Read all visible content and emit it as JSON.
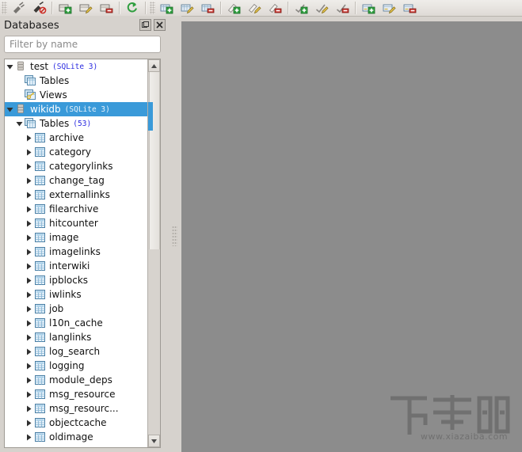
{
  "toolbar": {
    "groups": [
      {
        "name": "connect-group",
        "buttons": [
          {
            "name": "connect-icon",
            "glyph": "plug"
          },
          {
            "name": "disconnect-icon",
            "glyph": "plug-off"
          }
        ]
      },
      {
        "name": "database-group",
        "buttons": [
          {
            "name": "add-database-icon",
            "glyph": "db-add"
          },
          {
            "name": "edit-database-icon",
            "glyph": "db-edit"
          },
          {
            "name": "delete-database-icon",
            "glyph": "db-delete"
          }
        ]
      },
      {
        "name": "refresh-group",
        "buttons": [
          {
            "name": "refresh-icon",
            "glyph": "refresh"
          }
        ]
      },
      {
        "name": "table-group",
        "buttons": [
          {
            "name": "add-table-icon",
            "glyph": "table-add"
          },
          {
            "name": "edit-table-icon",
            "glyph": "table-edit"
          },
          {
            "name": "delete-table-icon",
            "glyph": "table-delete"
          }
        ]
      },
      {
        "name": "index-group",
        "buttons": [
          {
            "name": "add-index-icon",
            "glyph": "index-add"
          },
          {
            "name": "edit-index-icon",
            "glyph": "index-edit"
          },
          {
            "name": "delete-index-icon",
            "glyph": "index-delete"
          }
        ]
      },
      {
        "name": "trigger-group",
        "buttons": [
          {
            "name": "add-trigger-icon",
            "glyph": "trigger-add"
          },
          {
            "name": "edit-trigger-icon",
            "glyph": "trigger-edit"
          },
          {
            "name": "delete-trigger-icon",
            "glyph": "trigger-delete"
          }
        ]
      },
      {
        "name": "view-group",
        "buttons": [
          {
            "name": "add-view-icon",
            "glyph": "view-add"
          },
          {
            "name": "edit-view-icon",
            "glyph": "view-edit"
          },
          {
            "name": "delete-view-icon",
            "glyph": "view-delete"
          }
        ]
      }
    ]
  },
  "panel": {
    "title": "Databases",
    "float_button_label": "",
    "close_button_label": ""
  },
  "filter": {
    "value": "",
    "placeholder": "Filter by name"
  },
  "tree": {
    "nodes": [
      {
        "label": "test",
        "suffix": "(SQLite 3)",
        "indent": 0,
        "twisty": "down",
        "icon": "database-icon",
        "selected": false
      },
      {
        "label": "Tables",
        "suffix": "",
        "indent": 1,
        "twisty": "none",
        "icon": "tables-icon",
        "selected": false
      },
      {
        "label": "Views",
        "suffix": "",
        "indent": 1,
        "twisty": "none",
        "icon": "views-icon",
        "selected": false
      },
      {
        "label": "wikidb",
        "suffix": "(SQLite 3)",
        "indent": 0,
        "twisty": "down",
        "icon": "database-icon",
        "selected": true
      },
      {
        "label": "Tables",
        "suffix": "(53)",
        "indent": 1,
        "twisty": "down",
        "icon": "tables-icon",
        "selected": false
      },
      {
        "label": "archive",
        "suffix": "",
        "indent": 2,
        "twisty": "right",
        "icon": "table-icon",
        "selected": false
      },
      {
        "label": "category",
        "suffix": "",
        "indent": 2,
        "twisty": "right",
        "icon": "table-icon",
        "selected": false
      },
      {
        "label": "categorylinks",
        "suffix": "",
        "indent": 2,
        "twisty": "right",
        "icon": "table-icon",
        "selected": false
      },
      {
        "label": "change_tag",
        "suffix": "",
        "indent": 2,
        "twisty": "right",
        "icon": "table-icon",
        "selected": false
      },
      {
        "label": "externallinks",
        "suffix": "",
        "indent": 2,
        "twisty": "right",
        "icon": "table-icon",
        "selected": false
      },
      {
        "label": "filearchive",
        "suffix": "",
        "indent": 2,
        "twisty": "right",
        "icon": "table-icon",
        "selected": false
      },
      {
        "label": "hitcounter",
        "suffix": "",
        "indent": 2,
        "twisty": "right",
        "icon": "table-icon",
        "selected": false
      },
      {
        "label": "image",
        "suffix": "",
        "indent": 2,
        "twisty": "right",
        "icon": "table-icon",
        "selected": false
      },
      {
        "label": "imagelinks",
        "suffix": "",
        "indent": 2,
        "twisty": "right",
        "icon": "table-icon",
        "selected": false
      },
      {
        "label": "interwiki",
        "suffix": "",
        "indent": 2,
        "twisty": "right",
        "icon": "table-icon",
        "selected": false
      },
      {
        "label": "ipblocks",
        "suffix": "",
        "indent": 2,
        "twisty": "right",
        "icon": "table-icon",
        "selected": false
      },
      {
        "label": "iwlinks",
        "suffix": "",
        "indent": 2,
        "twisty": "right",
        "icon": "table-icon",
        "selected": false
      },
      {
        "label": "job",
        "suffix": "",
        "indent": 2,
        "twisty": "right",
        "icon": "table-icon",
        "selected": false
      },
      {
        "label": "l10n_cache",
        "suffix": "",
        "indent": 2,
        "twisty": "right",
        "icon": "table-icon",
        "selected": false
      },
      {
        "label": "langlinks",
        "suffix": "",
        "indent": 2,
        "twisty": "right",
        "icon": "table-icon",
        "selected": false
      },
      {
        "label": "log_search",
        "suffix": "",
        "indent": 2,
        "twisty": "right",
        "icon": "table-icon",
        "selected": false
      },
      {
        "label": "logging",
        "suffix": "",
        "indent": 2,
        "twisty": "right",
        "icon": "table-icon",
        "selected": false
      },
      {
        "label": "module_deps",
        "suffix": "",
        "indent": 2,
        "twisty": "right",
        "icon": "table-icon",
        "selected": false
      },
      {
        "label": "msg_resource",
        "suffix": "",
        "indent": 2,
        "twisty": "right",
        "icon": "table-icon",
        "selected": false
      },
      {
        "label": "msg_resourc...",
        "suffix": "",
        "indent": 2,
        "twisty": "right",
        "icon": "table-icon",
        "selected": false
      },
      {
        "label": "objectcache",
        "suffix": "",
        "indent": 2,
        "twisty": "right",
        "icon": "table-icon",
        "selected": false
      },
      {
        "label": "oldimage",
        "suffix": "",
        "indent": 2,
        "twisty": "right",
        "icon": "table-icon",
        "selected": false
      }
    ]
  },
  "scrollbar": {
    "up_arrow": "scroll-up-icon",
    "down_arrow": "scroll-down-icon"
  },
  "watermark": {
    "text": "下载吧",
    "url": "www.xiazaiba.com"
  },
  "colors": {
    "selection": "#3a9ad9",
    "panel_bg": "#d6d2cd",
    "main_bg": "#8c8c8c",
    "suffix_text": "#2b2be0"
  }
}
